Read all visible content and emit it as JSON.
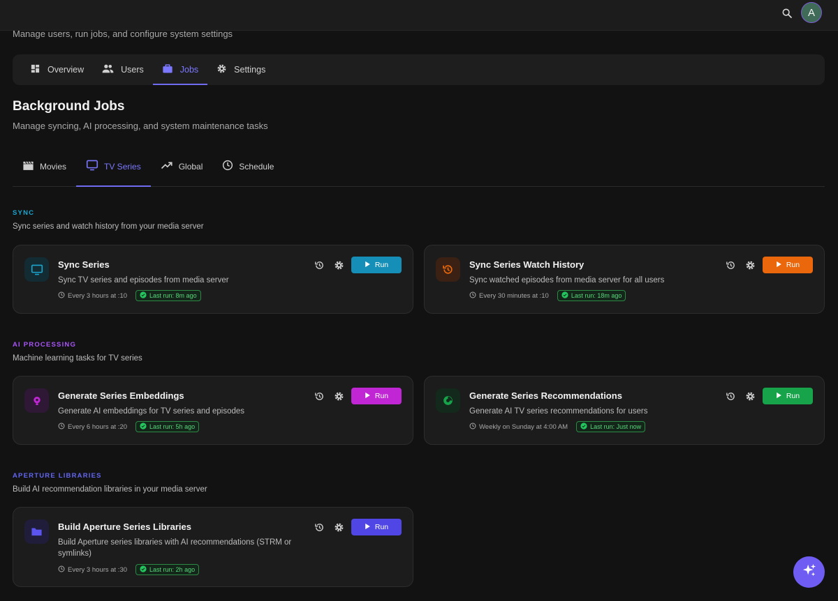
{
  "header": {
    "avatar_initial": "A",
    "subtitle": "Manage users, run jobs, and configure system settings"
  },
  "main_tabs": [
    {
      "label": "Overview",
      "icon": "dashboard-icon"
    },
    {
      "label": "Users",
      "icon": "users-icon"
    },
    {
      "label": "Jobs",
      "icon": "briefcase-icon",
      "active": true
    },
    {
      "label": "Settings",
      "icon": "gear-icon"
    }
  ],
  "page": {
    "title": "Background Jobs",
    "subtitle": "Manage syncing, AI processing, and system maintenance tasks"
  },
  "sub_tabs": [
    {
      "label": "Movies",
      "icon": "clapperboard-icon"
    },
    {
      "label": "TV Series",
      "icon": "tv-icon",
      "active": true
    },
    {
      "label": "Global",
      "icon": "trending-icon"
    },
    {
      "label": "Schedule",
      "icon": "clock-icon"
    }
  ],
  "groups": [
    {
      "label": "SYNC",
      "desc": "Sync series and watch history from your media server",
      "color": "#1ba6d0"
    },
    {
      "label": "AI PROCESSING",
      "desc": "Machine learning tasks for TV series",
      "color": "#a855f7"
    },
    {
      "label": "APERTURE LIBRARIES",
      "desc": "Build AI recommendation libraries in your media server",
      "color": "#6366f1"
    }
  ],
  "jobs": [
    {
      "title": "Sync Series",
      "desc": "Sync TV series and episodes from media server",
      "schedule": "Every 3 hours at :10",
      "last_run": "Last run: 8m ago",
      "run_label": "Run",
      "color": "#168fb8",
      "icon": "tv-icon"
    },
    {
      "title": "Sync Series Watch History",
      "desc": "Sync watched episodes from media server for all users",
      "schedule": "Every 30 minutes at :10",
      "last_run": "Last run: 18m ago",
      "run_label": "Run",
      "color": "#ea670c",
      "icon": "history-icon"
    },
    {
      "title": "Generate Series Embeddings",
      "desc": "Generate AI embeddings for TV series and episodes",
      "schedule": "Every 6 hours at :20",
      "last_run": "Last run: 5h ago",
      "run_label": "Run",
      "color": "#c026d3",
      "icon": "brain-icon"
    },
    {
      "title": "Generate Series Recommendations",
      "desc": "Generate AI TV series recommendations for users",
      "schedule": "Weekly on Sunday at 4:00 AM",
      "last_run": "Last run: Just now",
      "run_label": "Run",
      "color": "#16a34a",
      "icon": "sparkle-circle-icon"
    },
    {
      "title": "Build Aperture Series Libraries",
      "desc": "Build Aperture series libraries with AI recommendations (STRM or symlinks)",
      "schedule": "Every 3 hours at :30",
      "last_run": "Last run: 2h ago",
      "run_label": "Run",
      "color": "#4f46e5",
      "icon": "folder-icon"
    }
  ]
}
